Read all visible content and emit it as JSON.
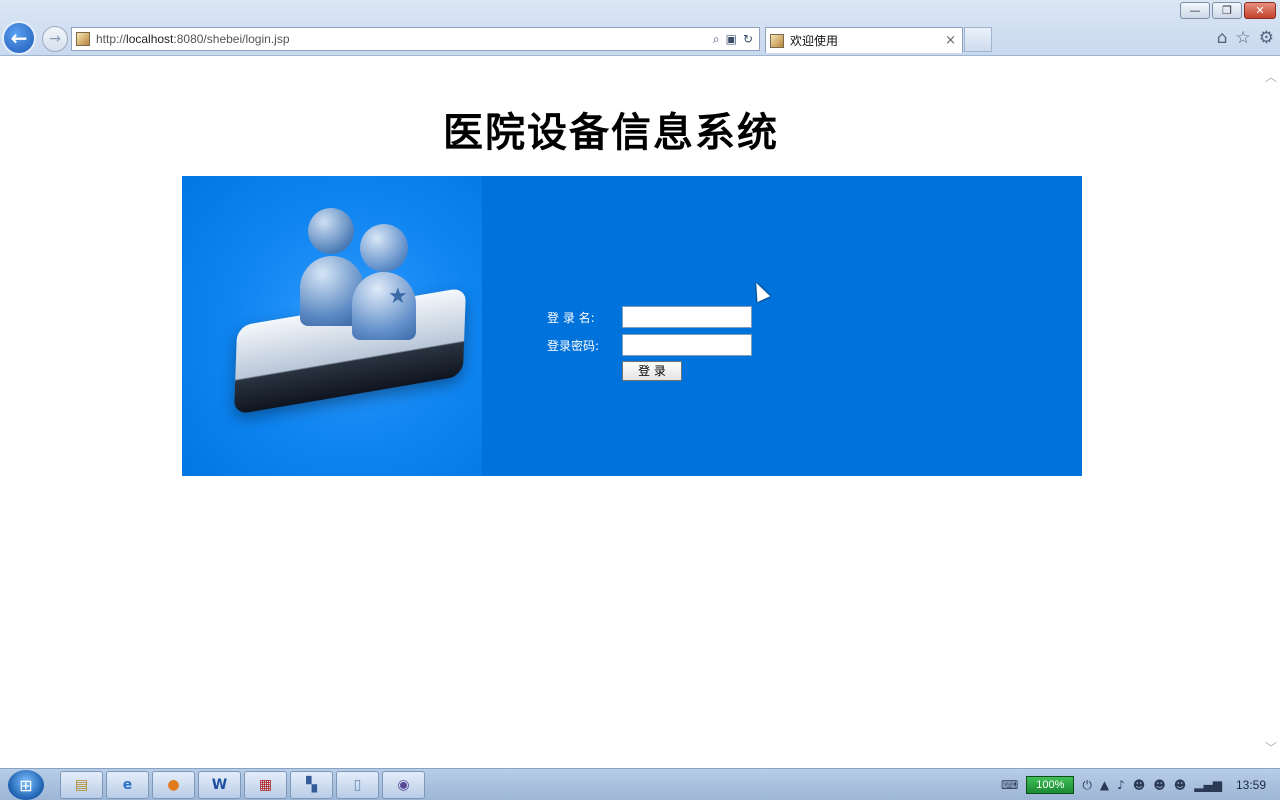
{
  "browser": {
    "url_prefix": "http://",
    "url_host": "localhost",
    "url_rest": ":8080/shebei/login.jsp",
    "tab_title": "欢迎使用",
    "back_symbol": "←",
    "forward_symbol": "→",
    "tab_close": "×",
    "window_minimize": "—",
    "window_restore": "❐",
    "window_close": "✕",
    "home_icon": "⌂",
    "favorites_icon": "☆",
    "settings_icon": "⚙",
    "search_icon": "⌕",
    "refresh_icon": "↻"
  },
  "page": {
    "title": "医院设备信息系统",
    "login_name_label": "登 录 名:",
    "password_label": "登录密码:",
    "login_button": "登  录",
    "login_name_value": "",
    "password_value": ""
  },
  "taskbar": {
    "battery": "100%",
    "clock": "13:59",
    "word_icon_letter": "W",
    "start_symbol": "⊞"
  },
  "colors": {
    "panel_blue": "#0072dc",
    "panel_light_blue": "#1d8ef6"
  }
}
